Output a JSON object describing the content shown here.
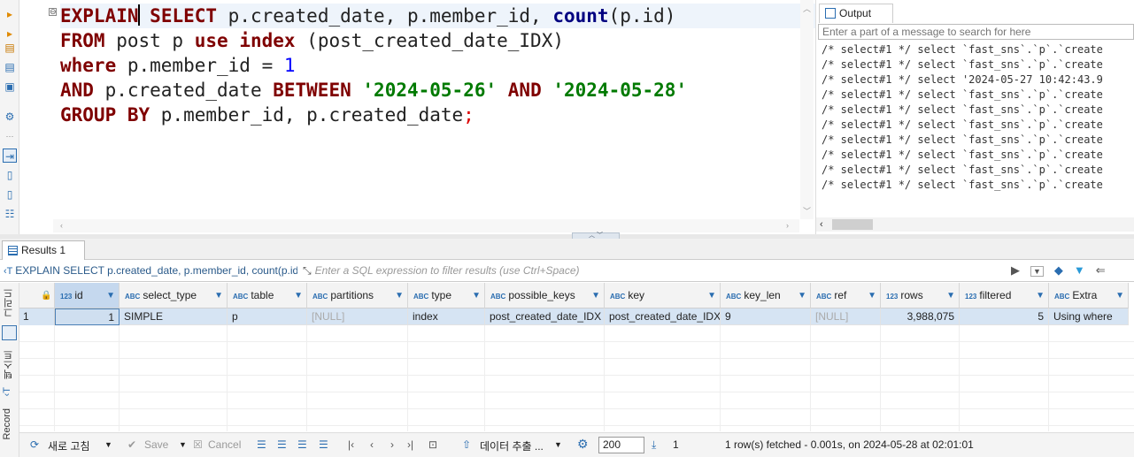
{
  "editor": {
    "lines": [
      [
        {
          "t": "EXPLAIN",
          "c": "kw"
        },
        {
          "t": "CURSOR",
          "c": "cursor"
        },
        {
          "t": " ",
          "c": "pl"
        },
        {
          "t": "SELECT",
          "c": "kw"
        },
        {
          "t": " p.created_date, p.member_id, ",
          "c": "pl"
        },
        {
          "t": "count",
          "c": "fn"
        },
        {
          "t": "(p.id)",
          "c": "pl"
        }
      ],
      [
        {
          "t": "FROM",
          "c": "kw"
        },
        {
          "t": " post p ",
          "c": "pl"
        },
        {
          "t": "use",
          "c": "kw"
        },
        {
          "t": " ",
          "c": "pl"
        },
        {
          "t": "index",
          "c": "kw"
        },
        {
          "t": " (post_created_date_IDX)",
          "c": "pl"
        }
      ],
      [
        {
          "t": "where",
          "c": "kw"
        },
        {
          "t": " p.member_id = ",
          "c": "pl"
        },
        {
          "t": "1",
          "c": "num"
        }
      ],
      [
        {
          "t": "AND",
          "c": "kw"
        },
        {
          "t": " p.created_date ",
          "c": "pl"
        },
        {
          "t": "BETWEEN",
          "c": "kw"
        },
        {
          "t": " ",
          "c": "pl"
        },
        {
          "t": "'2024-05-26'",
          "c": "str"
        },
        {
          "t": " ",
          "c": "pl"
        },
        {
          "t": "AND",
          "c": "kw"
        },
        {
          "t": " ",
          "c": "pl"
        },
        {
          "t": "'2024-05-28'",
          "c": "str"
        }
      ],
      [
        {
          "t": "GROUP BY",
          "c": "kw"
        },
        {
          "t": " p.member_id, p.created_date",
          "c": "pl"
        },
        {
          "t": ";",
          "c": "semi"
        }
      ]
    ]
  },
  "output": {
    "tab_label": "Output",
    "search_placeholder": "Enter a part of a message to search for here",
    "lines": [
      "/* select#1 */ select `fast_sns`.`p`.`create",
      "/* select#1 */ select `fast_sns`.`p`.`create",
      "/* select#1 */ select '2024-05-27 10:42:43.9",
      "/* select#1 */ select `fast_sns`.`p`.`create",
      "/* select#1 */ select `fast_sns`.`p`.`create",
      "/* select#1 */ select `fast_sns`.`p`.`create",
      "/* select#1 */ select `fast_sns`.`p`.`create",
      "/* select#1 */ select `fast_sns`.`p`.`create",
      "/* select#1 */ select `fast_sns`.`p`.`create",
      "/* select#1 */ select `fast_sns`.`p`.`create"
    ]
  },
  "results": {
    "tab_label": "Results 1",
    "query_text": "EXPLAIN SELECT p.created_date, p.member_id, count(p.id",
    "filter_placeholder": "Enter a SQL expression to filter results (use Ctrl+Space)",
    "side_labels": {
      "grid": "그리드",
      "text": "텍스트",
      "record": "Record"
    },
    "columns": [
      {
        "type": "123",
        "name": "id"
      },
      {
        "type": "ABC",
        "name": "select_type"
      },
      {
        "type": "ABC",
        "name": "table"
      },
      {
        "type": "ABC",
        "name": "partitions"
      },
      {
        "type": "ABC",
        "name": "type"
      },
      {
        "type": "ABC",
        "name": "possible_keys"
      },
      {
        "type": "ABC",
        "name": "key"
      },
      {
        "type": "ABC",
        "name": "key_len"
      },
      {
        "type": "ABC",
        "name": "ref"
      },
      {
        "type": "123",
        "name": "rows"
      },
      {
        "type": "123",
        "name": "filtered"
      },
      {
        "type": "ABC",
        "name": "Extra"
      }
    ],
    "rows": [
      {
        "num": "1",
        "cells": [
          "1",
          "SIMPLE",
          "p",
          "[NULL]",
          "index",
          "post_created_date_IDX",
          "post_created_date_IDX",
          "9",
          "[NULL]",
          "3,988,075",
          "5",
          "Using where"
        ]
      }
    ]
  },
  "statusbar": {
    "refresh": "새로 고침",
    "save": "Save",
    "cancel": "Cancel",
    "export": "데이터 추출 ...",
    "fetch_size": "200",
    "row_count": "1",
    "status": "1 row(s) fetched - 0.001s, on 2024-05-28 at 02:01:01"
  }
}
